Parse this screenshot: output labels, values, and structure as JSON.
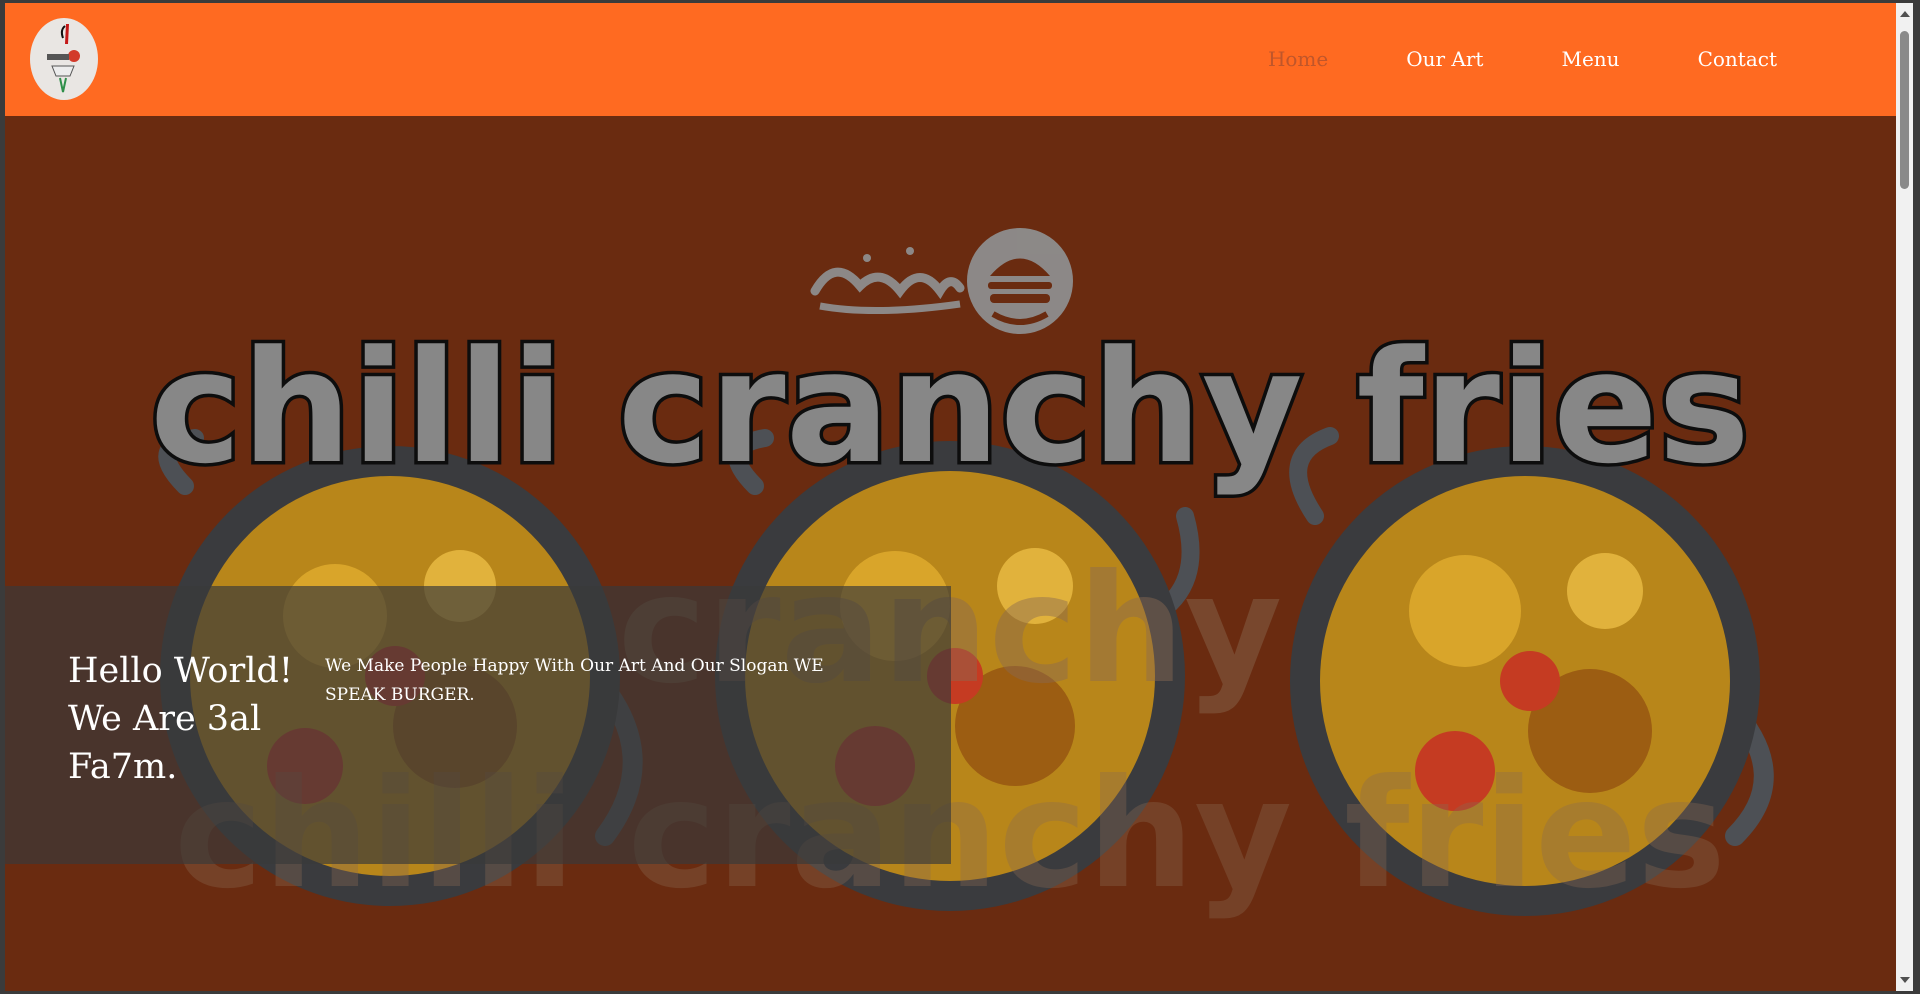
{
  "logo": {
    "alt": "3al Fa7m logo"
  },
  "nav": {
    "items": [
      {
        "label": "Home",
        "active": true
      },
      {
        "label": "Our Art",
        "active": false
      },
      {
        "label": "Menu",
        "active": false
      },
      {
        "label": "Contact",
        "active": false
      }
    ]
  },
  "hero": {
    "banner_heading": "chilli cranchy fries",
    "title": "Hello World! We Are 3al Fa7m.",
    "text": "We Make People Happy With Our Art And Our Slogan WE SPEAK BURGER."
  },
  "colors": {
    "navbar": "#ff6a21",
    "hero_background": "#6a2b10",
    "active_nav": "#c0562a",
    "overlay": "#3a3a3a"
  },
  "icons": [
    "logo-icon",
    "burger-icon",
    "scroll-up-icon",
    "scroll-down-icon"
  ]
}
